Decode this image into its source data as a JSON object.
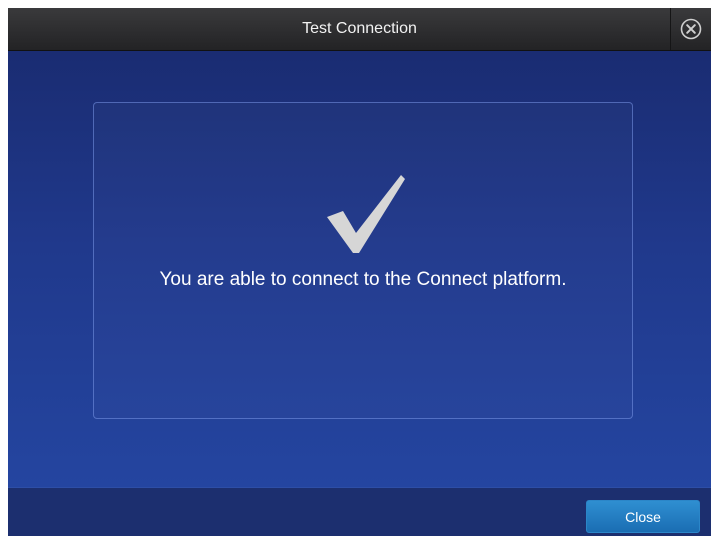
{
  "dialog": {
    "title": "Test Connection",
    "message": "You are able to connect to the Connect platform.",
    "status_icon": "checkmark-icon",
    "close_icon": "close-circle-icon",
    "close_label": "Close"
  },
  "colors": {
    "titlebar": "#2b2b2d",
    "body": "#20398c",
    "button": "#2480c4",
    "check": "#d6d6d6"
  }
}
